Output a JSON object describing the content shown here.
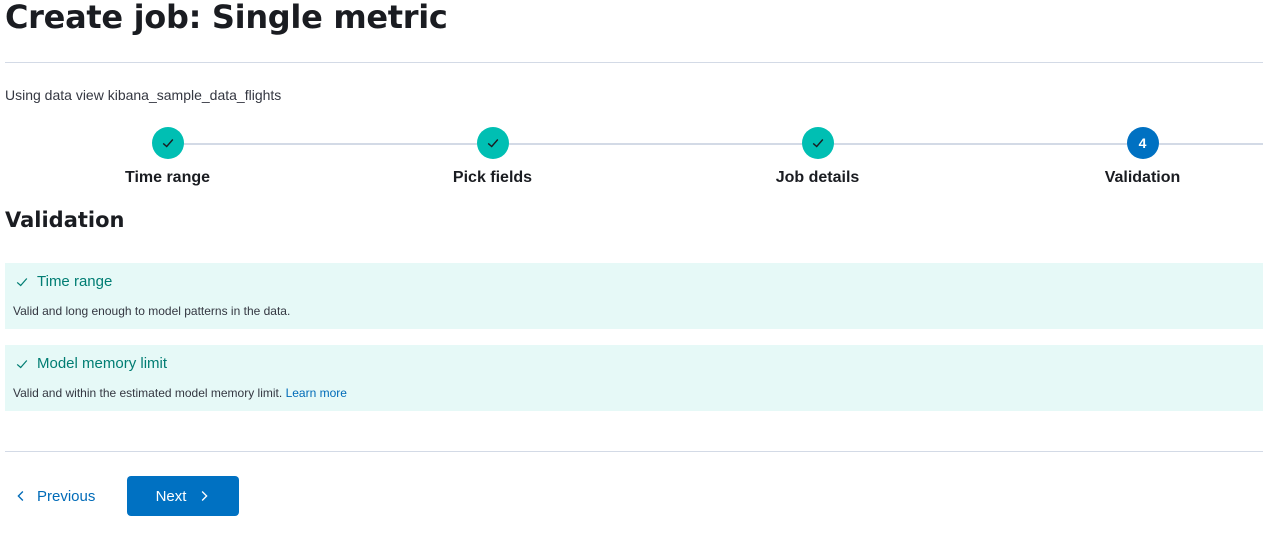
{
  "page": {
    "title": "Create job: Single metric",
    "subtitle": "Using data view kibana_sample_data_flights"
  },
  "steps": [
    {
      "label": "Time range",
      "status": "complete",
      "icon": "check-icon"
    },
    {
      "label": "Pick fields",
      "status": "complete",
      "icon": "check-icon"
    },
    {
      "label": "Job details",
      "status": "complete",
      "icon": "check-icon"
    },
    {
      "label": "Validation",
      "status": "current",
      "number": "4"
    }
  ],
  "validation": {
    "title": "Validation",
    "callouts": [
      {
        "title": "Time range",
        "text": "Valid and long enough to model patterns in the data.",
        "icon": "check-icon"
      },
      {
        "title": "Model memory limit",
        "text": "Valid and within the estimated model memory limit.",
        "link": "Learn more",
        "icon": "check-icon"
      }
    ]
  },
  "nav": {
    "previous_label": "Previous",
    "next_label": "Next"
  },
  "colors": {
    "step_complete": "#00bfb3",
    "step_current": "#0071c2",
    "success_bg": "#e6f9f7",
    "success_text": "#017d73",
    "primary": "#0071c2",
    "link": "#006bb8"
  }
}
